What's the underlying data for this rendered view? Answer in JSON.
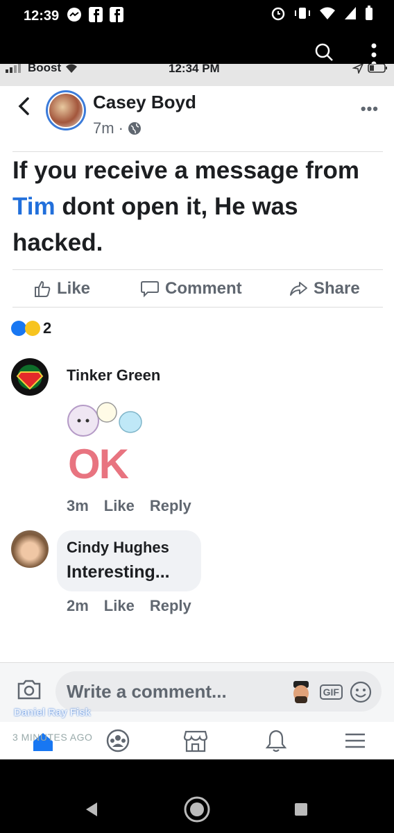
{
  "android_status": {
    "time": "12:39"
  },
  "ios_status": {
    "carrier": "Boost",
    "time": "12:34 PM"
  },
  "post": {
    "author": "Casey Boyd",
    "age": "7m",
    "text_before": "If you receive a message from ",
    "mention": "Tim",
    "text_after": " dont open it, He was hacked.",
    "actions": {
      "like": "Like",
      "comment": "Comment",
      "share": "Share"
    },
    "reaction_count": "2"
  },
  "comments": [
    {
      "name": "Tinker Green",
      "sticker": "OK",
      "age": "3m",
      "like": "Like",
      "reply": "Reply"
    },
    {
      "name": "Cindy Hughes",
      "text": "Interesting...",
      "age": "2m",
      "like": "Like",
      "reply": "Reply"
    }
  ],
  "composer": {
    "placeholder": "Write a comment...",
    "gif": "GIF"
  },
  "watermark": {
    "name": "Daniel Ray Fisk",
    "when": "3 MINUTES AGO"
  },
  "colors": {
    "accent": "#216fdb",
    "muted": "#606770",
    "bubble": "#f0f2f5"
  }
}
